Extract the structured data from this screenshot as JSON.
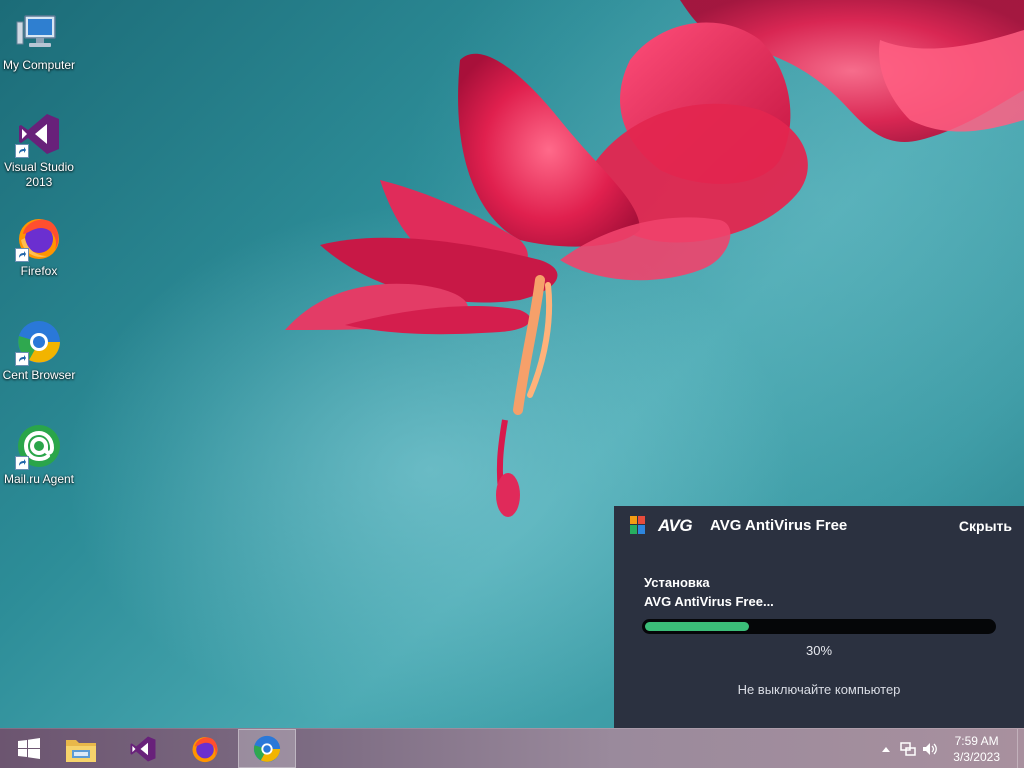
{
  "desktop_icons": [
    {
      "label": "My Computer",
      "icon": "computer-icon"
    },
    {
      "label": "Visual Studio\n2013",
      "icon": "visual-studio-icon",
      "shortcut": true
    },
    {
      "label": "Firefox",
      "icon": "firefox-icon",
      "shortcut": true
    },
    {
      "label": "Cent Browser",
      "icon": "cent-browser-icon",
      "shortcut": true
    },
    {
      "label": "Mail.ru Agent",
      "icon": "mailru-agent-icon",
      "shortcut": true
    }
  ],
  "avg_panel": {
    "logo_text": "AVG",
    "title": "AVG AntiVirus Free",
    "hide_label": "Скрыть",
    "status_line1": "Установка",
    "status_line2": "AVG AntiVirus Free...",
    "progress_fraction": 0.3,
    "progress_label": "30%",
    "note": "Не выключайте компьютер",
    "accent_color": "#3bbd78",
    "background_color": "#2b3140"
  },
  "taskbar": {
    "pinned": [
      {
        "icon": "windows-start-icon"
      },
      {
        "icon": "file-explorer-icon"
      },
      {
        "icon": "visual-studio-icon"
      },
      {
        "icon": "firefox-icon"
      },
      {
        "icon": "cent-browser-icon",
        "active": true
      }
    ],
    "tray": {
      "icons": [
        "show-hidden-icons-chevron-icon",
        "network-icon",
        "volume-icon"
      ],
      "time": "7:59 AM",
      "date": "3/3/2023"
    }
  }
}
